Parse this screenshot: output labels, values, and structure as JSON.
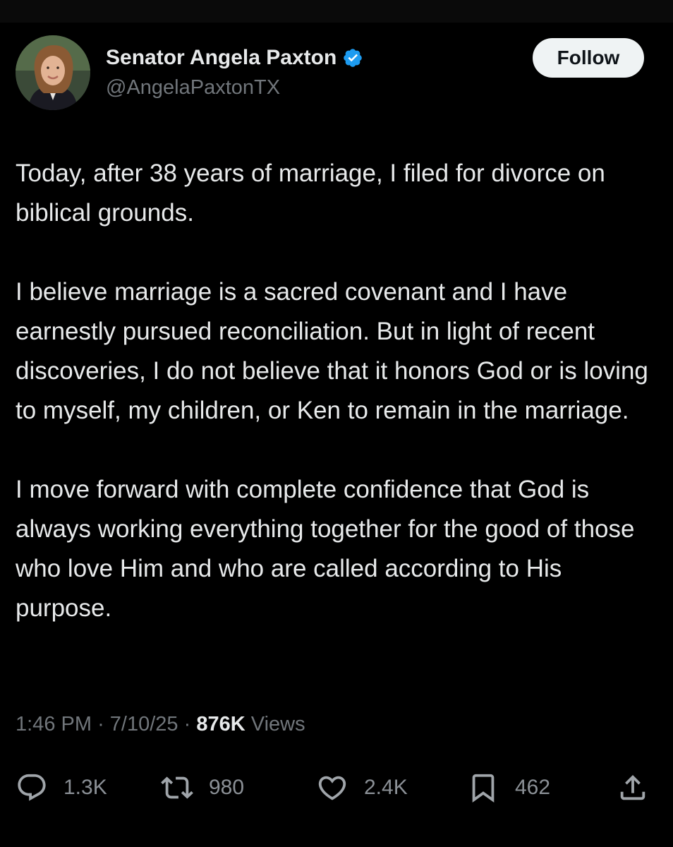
{
  "author": {
    "display_name": "Senator Angela Paxton",
    "handle": "@AngelaPaxtonTX",
    "verified": true,
    "avatar_icon": "profile-photo"
  },
  "follow_label": "Follow",
  "tweet": {
    "paragraphs": [
      "Today, after 38 years of marriage, I filed for divorce on biblical grounds.",
      "I believe marriage is a sacred covenant and I have earnestly pursued reconciliation. But in light of recent discoveries, I do not believe that it honors God or is loving to myself, my children, or Ken to remain in the marriage.",
      "I move forward with complete confidence that God is always working everything together for the good of those who love Him and who are called according to His purpose."
    ]
  },
  "meta": {
    "time": "1:46 PM",
    "separator": "·",
    "date": "7/10/25",
    "views_count": "876K",
    "views_label": "Views"
  },
  "actions": {
    "replies": "1.3K",
    "reposts": "980",
    "likes": "2.4K",
    "bookmarks": "462"
  },
  "colors": {
    "background": "#000000",
    "text_primary": "#e7e9ea",
    "text_secondary": "#71767b",
    "verified_blue": "#1d9bf0",
    "follow_bg": "#eff3f4"
  }
}
